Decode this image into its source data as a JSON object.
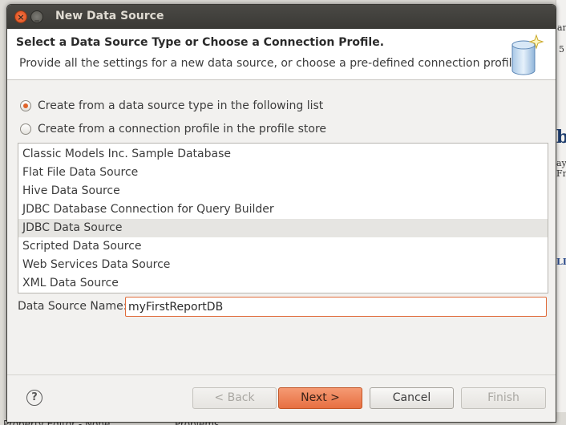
{
  "window": {
    "title": "New Data Source"
  },
  "header": {
    "title": "Select a Data Source Type or Choose a Connection Profile.",
    "description": "Provide all the settings for a new data source, or choose a pre-defined connection profile."
  },
  "options": {
    "create_from_type": "Create from a data source type in the following list",
    "create_from_profile": "Create from a connection profile in the profile store"
  },
  "data_sources": [
    "Classic Models Inc. Sample Database",
    "Flat File Data Source",
    "Hive Data Source",
    "JDBC Database Connection for Query Builder",
    "JDBC Data Source",
    "Scripted Data Source",
    "Web Services Data Source",
    "XML Data Source"
  ],
  "selected_data_source": "JDBC Data Source",
  "name_field": {
    "label": "Data Source Name:",
    "value": "myFirstReportDB"
  },
  "buttons": {
    "back": "< Back",
    "next": "Next >",
    "cancel": "Cancel",
    "finish": "Finish",
    "help": "?"
  },
  "background": {
    "right_fragments": [
      "ar",
      "5",
      "bc",
      "ay",
      "Fra",
      "LIN"
    ],
    "bottom_left": "Property Editor - None",
    "bottom_right": "Problems"
  },
  "colors": {
    "accent": "#e76f41",
    "title_bar": "#3d3c38",
    "selection": "#e6e5e2"
  }
}
